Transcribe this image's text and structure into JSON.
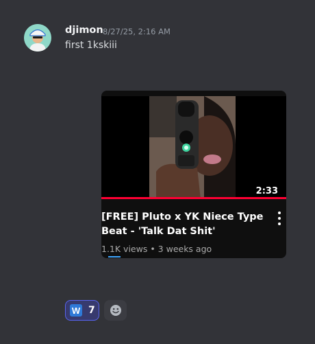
{
  "message": {
    "author": "djimon",
    "timestamp": "8/27/25, 2:16 AM",
    "text": "first 1kskiii"
  },
  "embed": {
    "title": "[FREE] Pluto x YK Niece Type Beat - 'Talk Dat Shit'",
    "meta": "1.1K views • 3 weeks ago",
    "duration": "2:33",
    "progress_watched": 1.0
  },
  "reactions": [
    {
      "emoji": "W",
      "count": "7",
      "selected": true
    }
  ],
  "colors": {
    "background": "#323338",
    "accent": "#5865f2",
    "progress": "#ff0033"
  },
  "icons": {
    "more": "more-vertical-icon",
    "add_reaction": "smile-add-icon"
  }
}
